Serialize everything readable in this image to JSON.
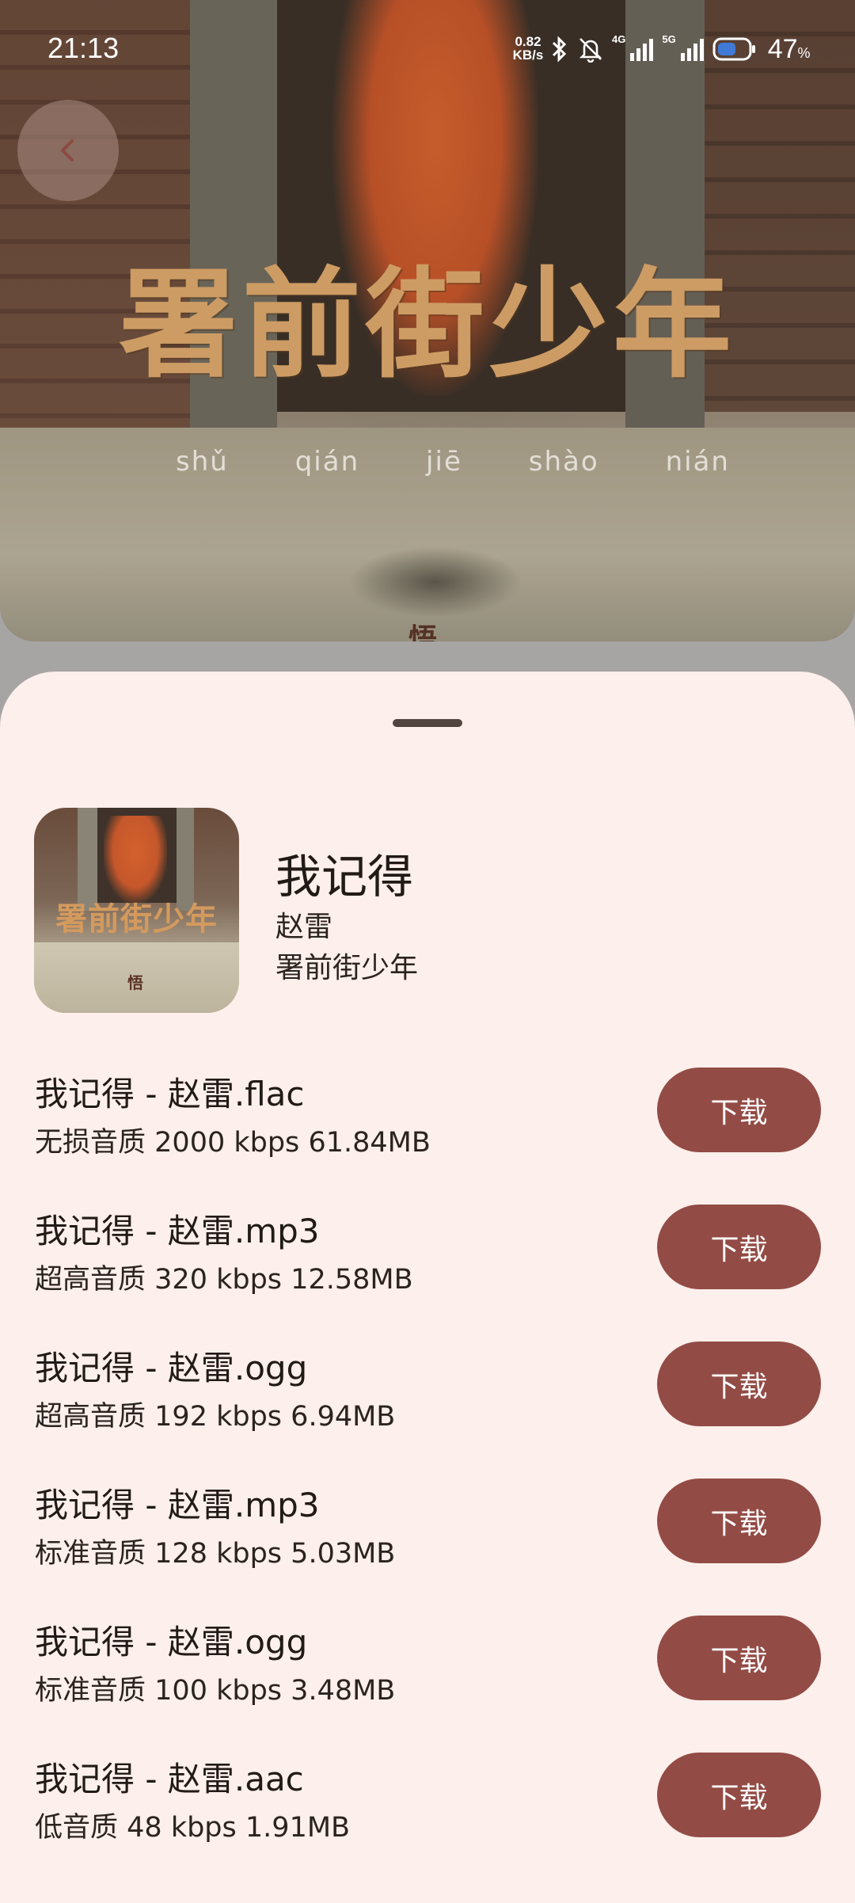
{
  "status_bar": {
    "time": "21:13",
    "net_speed_value": "0.82",
    "net_speed_unit": "KB/s",
    "net1": "4G",
    "net2": "5G",
    "battery": "47",
    "battery_unit": "%"
  },
  "hero": {
    "calligraphy": "署前街少年",
    "pinyin": [
      "shǔ",
      "qián",
      "jiē",
      "shào",
      "nián"
    ],
    "stamp": "悟"
  },
  "cover": {
    "title": "署前街少年",
    "stamp": "悟"
  },
  "song": {
    "title": "我记得",
    "artist": "赵雷",
    "album": "署前街少年"
  },
  "downloads": [
    {
      "file": "我记得 - 赵雷.flac",
      "quality": "无损音质",
      "bitrate": "2000 kbps",
      "size": "61.84MB",
      "button": "下载"
    },
    {
      "file": "我记得 - 赵雷.mp3",
      "quality": "超高音质",
      "bitrate": "320 kbps",
      "size": "12.58MB",
      "button": "下载"
    },
    {
      "file": "我记得 - 赵雷.ogg",
      "quality": "超高音质",
      "bitrate": "192 kbps",
      "size": "6.94MB",
      "button": "下载"
    },
    {
      "file": "我记得 - 赵雷.mp3",
      "quality": "标准音质",
      "bitrate": "128 kbps",
      "size": "5.03MB",
      "button": "下载"
    },
    {
      "file": "我记得 - 赵雷.ogg",
      "quality": "标准音质",
      "bitrate": "100 kbps",
      "size": "3.48MB",
      "button": "下载"
    },
    {
      "file": "我记得 - 赵雷.aac",
      "quality": "低音质",
      "bitrate": "48 kbps",
      "size": "1.91MB",
      "button": "下载"
    }
  ],
  "icons": {
    "back": "chevron-left-icon",
    "bluetooth": "bluetooth-icon",
    "mute": "bell-off-icon",
    "signal": "signal-icon",
    "battery": "battery-icon"
  },
  "colors": {
    "sheet_bg": "#fdefeb",
    "button_bg": "#934b45",
    "button_text": "#ffffff",
    "text_primary": "#211a17"
  }
}
